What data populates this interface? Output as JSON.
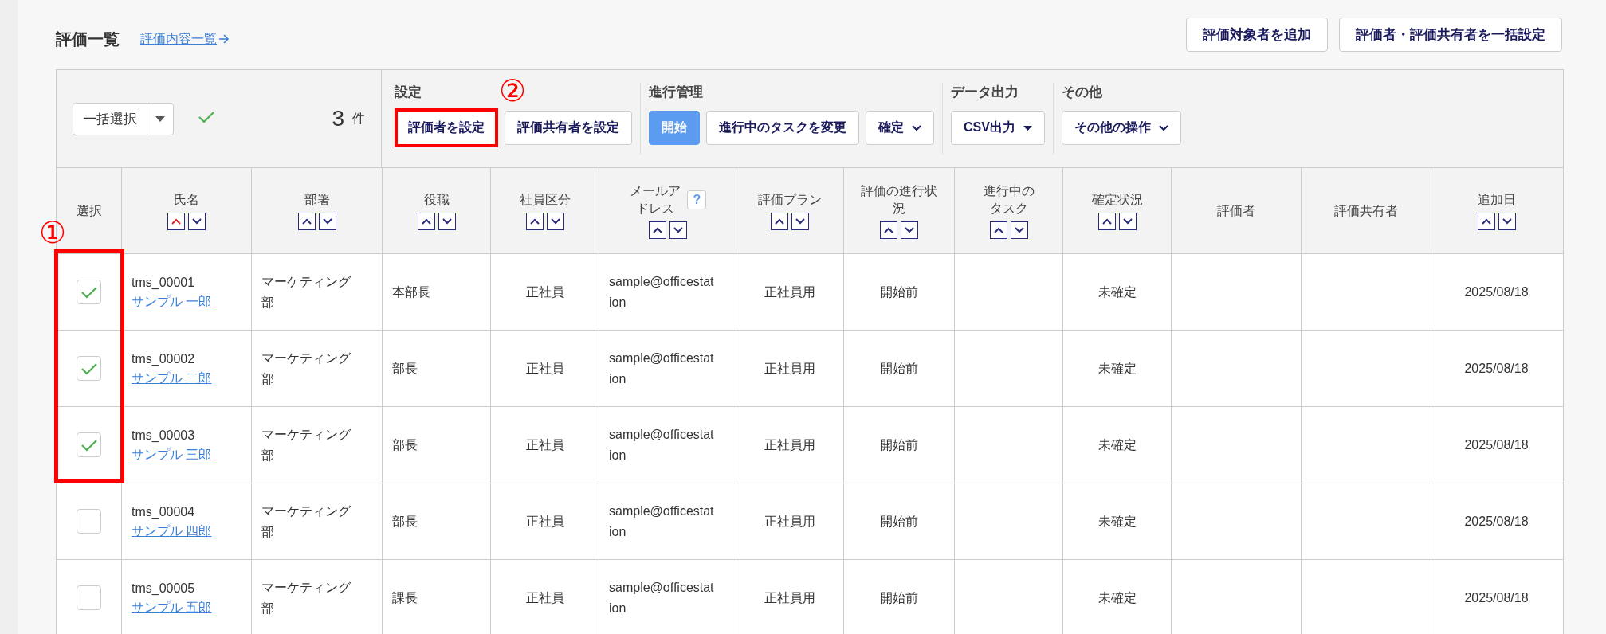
{
  "page": {
    "title": "評価一覧",
    "link": "評価内容一覧",
    "actions": [
      "評価対象者を追加",
      "評価者・評価共有者を一括設定"
    ]
  },
  "toolbar": {
    "bulk_select": "一括選択",
    "count": "3",
    "count_unit": "件",
    "groups": [
      {
        "label": "設定",
        "buttons": [
          {
            "label": "評価者を設定",
            "kind": "plain",
            "highlighted": true
          },
          {
            "label": "評価共有者を設定",
            "kind": "plain",
            "highlighted": false
          }
        ]
      },
      {
        "label": "進行管理",
        "buttons": [
          {
            "label": "開始",
            "kind": "primary",
            "highlighted": false
          },
          {
            "label": "進行中のタスクを変更",
            "kind": "plain",
            "highlighted": false
          },
          {
            "label": "確定",
            "kind": "menu",
            "highlighted": false
          }
        ]
      },
      {
        "label": "データ出力",
        "buttons": [
          {
            "label": "CSV出力",
            "kind": "dropdown",
            "highlighted": false
          }
        ]
      },
      {
        "label": "その他",
        "buttons": [
          {
            "label": "その他の操作",
            "kind": "menu",
            "highlighted": false
          }
        ]
      }
    ]
  },
  "table": {
    "columns": [
      {
        "label": "選択",
        "kind": "checkbox",
        "sortable": false
      },
      {
        "label": "氏名",
        "kind": "person",
        "sortable": true,
        "sorted_asc": true
      },
      {
        "label": "部署",
        "kind": "left",
        "sortable": true,
        "sorted_asc": false
      },
      {
        "label": "役職",
        "kind": "left",
        "sortable": true,
        "sorted_asc": false
      },
      {
        "label": "社員区分",
        "kind": "center",
        "sortable": true,
        "sorted_asc": false
      },
      {
        "label": "メールアドレス",
        "kind": "left",
        "sortable": true,
        "sorted_asc": false,
        "help": "?"
      },
      {
        "label": "評価プラン",
        "kind": "center",
        "sortable": true,
        "sorted_asc": false
      },
      {
        "label": "評価の進行状況",
        "kind": "center",
        "sortable": true,
        "sorted_asc": false
      },
      {
        "label": "進行中のタスク",
        "kind": "center",
        "sortable": true,
        "sorted_asc": false
      },
      {
        "label": "確定状況",
        "kind": "center",
        "sortable": true,
        "sorted_asc": false
      },
      {
        "label": "評価者",
        "kind": "center",
        "sortable": false
      },
      {
        "label": "評価共有者",
        "kind": "center",
        "sortable": false
      },
      {
        "label": "追加日",
        "kind": "center",
        "sortable": true,
        "sorted_asc": false
      }
    ],
    "rows": [
      {
        "cells": [
          {
            "selected": true
          },
          {
            "id": "tms_00001",
            "name": "サンプル 一郎"
          },
          "マーケティング部",
          "本部長",
          "正社員",
          "sample@officestation",
          "正社員用",
          "開始前",
          "",
          "未確定",
          "",
          "",
          "2025/08/18"
        ]
      },
      {
        "cells": [
          {
            "selected": true
          },
          {
            "id": "tms_00002",
            "name": "サンプル 二郎"
          },
          "マーケティング部",
          "部長",
          "正社員",
          "sample@officestation",
          "正社員用",
          "開始前",
          "",
          "未確定",
          "",
          "",
          "2025/08/18"
        ]
      },
      {
        "cells": [
          {
            "selected": true
          },
          {
            "id": "tms_00003",
            "name": "サンプル 三郎"
          },
          "マーケティング部",
          "部長",
          "正社員",
          "sample@officestation",
          "正社員用",
          "開始前",
          "",
          "未確定",
          "",
          "",
          "2025/08/18"
        ]
      },
      {
        "cells": [
          {
            "selected": false
          },
          {
            "id": "tms_00004",
            "name": "サンプル 四郎"
          },
          "マーケティング部",
          "部長",
          "正社員",
          "sample@officestation",
          "正社員用",
          "開始前",
          "",
          "未確定",
          "",
          "",
          "2025/08/18"
        ]
      },
      {
        "cells": [
          {
            "selected": false
          },
          {
            "id": "tms_00005",
            "name": "サンプル 五郎"
          },
          "マーケティング部",
          "課長",
          "正社員",
          "sample@officestation",
          "正社員用",
          "開始前",
          "",
          "未確定",
          "",
          "",
          "2025/08/18"
        ]
      }
    ]
  },
  "callouts": [
    "①",
    "②"
  ]
}
